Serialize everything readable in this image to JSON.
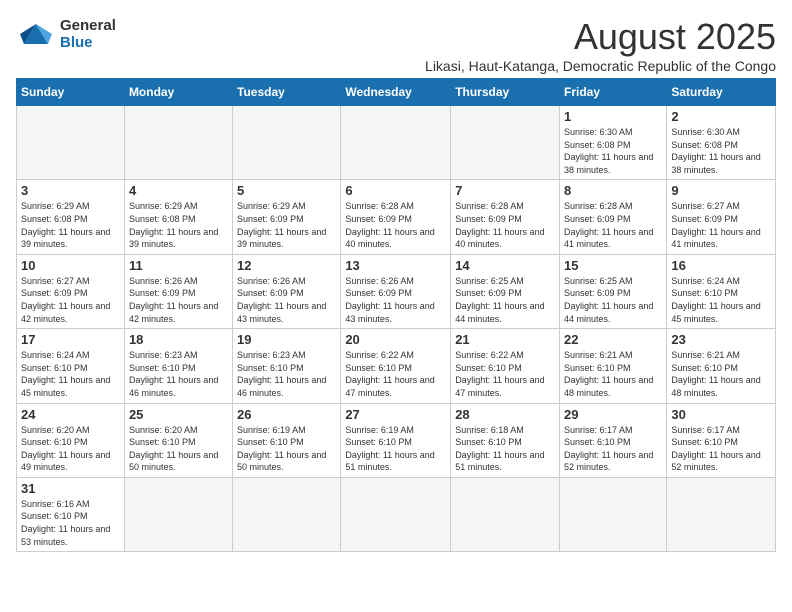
{
  "header": {
    "logo_general": "General",
    "logo_blue": "Blue",
    "month_title": "August 2025",
    "location": "Likasi, Haut-Katanga, Democratic Republic of the Congo"
  },
  "weekdays": [
    "Sunday",
    "Monday",
    "Tuesday",
    "Wednesday",
    "Thursday",
    "Friday",
    "Saturday"
  ],
  "weeks": [
    [
      {
        "day": "",
        "info": ""
      },
      {
        "day": "",
        "info": ""
      },
      {
        "day": "",
        "info": ""
      },
      {
        "day": "",
        "info": ""
      },
      {
        "day": "",
        "info": ""
      },
      {
        "day": "1",
        "info": "Sunrise: 6:30 AM\nSunset: 6:08 PM\nDaylight: 11 hours and 38 minutes."
      },
      {
        "day": "2",
        "info": "Sunrise: 6:30 AM\nSunset: 6:08 PM\nDaylight: 11 hours and 38 minutes."
      }
    ],
    [
      {
        "day": "3",
        "info": "Sunrise: 6:29 AM\nSunset: 6:08 PM\nDaylight: 11 hours and 39 minutes."
      },
      {
        "day": "4",
        "info": "Sunrise: 6:29 AM\nSunset: 6:08 PM\nDaylight: 11 hours and 39 minutes."
      },
      {
        "day": "5",
        "info": "Sunrise: 6:29 AM\nSunset: 6:09 PM\nDaylight: 11 hours and 39 minutes."
      },
      {
        "day": "6",
        "info": "Sunrise: 6:28 AM\nSunset: 6:09 PM\nDaylight: 11 hours and 40 minutes."
      },
      {
        "day": "7",
        "info": "Sunrise: 6:28 AM\nSunset: 6:09 PM\nDaylight: 11 hours and 40 minutes."
      },
      {
        "day": "8",
        "info": "Sunrise: 6:28 AM\nSunset: 6:09 PM\nDaylight: 11 hours and 41 minutes."
      },
      {
        "day": "9",
        "info": "Sunrise: 6:27 AM\nSunset: 6:09 PM\nDaylight: 11 hours and 41 minutes."
      }
    ],
    [
      {
        "day": "10",
        "info": "Sunrise: 6:27 AM\nSunset: 6:09 PM\nDaylight: 11 hours and 42 minutes."
      },
      {
        "day": "11",
        "info": "Sunrise: 6:26 AM\nSunset: 6:09 PM\nDaylight: 11 hours and 42 minutes."
      },
      {
        "day": "12",
        "info": "Sunrise: 6:26 AM\nSunset: 6:09 PM\nDaylight: 11 hours and 43 minutes."
      },
      {
        "day": "13",
        "info": "Sunrise: 6:26 AM\nSunset: 6:09 PM\nDaylight: 11 hours and 43 minutes."
      },
      {
        "day": "14",
        "info": "Sunrise: 6:25 AM\nSunset: 6:09 PM\nDaylight: 11 hours and 44 minutes."
      },
      {
        "day": "15",
        "info": "Sunrise: 6:25 AM\nSunset: 6:09 PM\nDaylight: 11 hours and 44 minutes."
      },
      {
        "day": "16",
        "info": "Sunrise: 6:24 AM\nSunset: 6:10 PM\nDaylight: 11 hours and 45 minutes."
      }
    ],
    [
      {
        "day": "17",
        "info": "Sunrise: 6:24 AM\nSunset: 6:10 PM\nDaylight: 11 hours and 45 minutes."
      },
      {
        "day": "18",
        "info": "Sunrise: 6:23 AM\nSunset: 6:10 PM\nDaylight: 11 hours and 46 minutes."
      },
      {
        "day": "19",
        "info": "Sunrise: 6:23 AM\nSunset: 6:10 PM\nDaylight: 11 hours and 46 minutes."
      },
      {
        "day": "20",
        "info": "Sunrise: 6:22 AM\nSunset: 6:10 PM\nDaylight: 11 hours and 47 minutes."
      },
      {
        "day": "21",
        "info": "Sunrise: 6:22 AM\nSunset: 6:10 PM\nDaylight: 11 hours and 47 minutes."
      },
      {
        "day": "22",
        "info": "Sunrise: 6:21 AM\nSunset: 6:10 PM\nDaylight: 11 hours and 48 minutes."
      },
      {
        "day": "23",
        "info": "Sunrise: 6:21 AM\nSunset: 6:10 PM\nDaylight: 11 hours and 48 minutes."
      }
    ],
    [
      {
        "day": "24",
        "info": "Sunrise: 6:20 AM\nSunset: 6:10 PM\nDaylight: 11 hours and 49 minutes."
      },
      {
        "day": "25",
        "info": "Sunrise: 6:20 AM\nSunset: 6:10 PM\nDaylight: 11 hours and 50 minutes."
      },
      {
        "day": "26",
        "info": "Sunrise: 6:19 AM\nSunset: 6:10 PM\nDaylight: 11 hours and 50 minutes."
      },
      {
        "day": "27",
        "info": "Sunrise: 6:19 AM\nSunset: 6:10 PM\nDaylight: 11 hours and 51 minutes."
      },
      {
        "day": "28",
        "info": "Sunrise: 6:18 AM\nSunset: 6:10 PM\nDaylight: 11 hours and 51 minutes."
      },
      {
        "day": "29",
        "info": "Sunrise: 6:17 AM\nSunset: 6:10 PM\nDaylight: 11 hours and 52 minutes."
      },
      {
        "day": "30",
        "info": "Sunrise: 6:17 AM\nSunset: 6:10 PM\nDaylight: 11 hours and 52 minutes."
      }
    ],
    [
      {
        "day": "31",
        "info": "Sunrise: 6:16 AM\nSunset: 6:10 PM\nDaylight: 11 hours and 53 minutes."
      },
      {
        "day": "",
        "info": ""
      },
      {
        "day": "",
        "info": ""
      },
      {
        "day": "",
        "info": ""
      },
      {
        "day": "",
        "info": ""
      },
      {
        "day": "",
        "info": ""
      },
      {
        "day": "",
        "info": ""
      }
    ]
  ]
}
